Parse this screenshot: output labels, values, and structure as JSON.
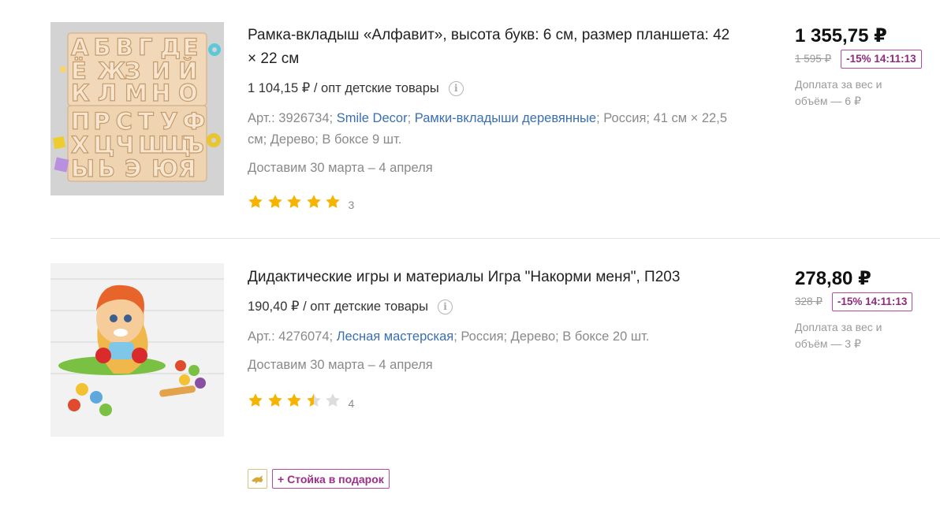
{
  "products": [
    {
      "title": "Рамка-вкладыш «Алфавит», высота букв: 6 см, размер планшета: 42 × 22 см",
      "wholesale": "1 104,15 ₽ / опт детские товары",
      "meta": {
        "art": "Арт.: 3926734",
        "brand": "Smile Decor",
        "category": "Рамки-вкладыши деревянные",
        "details": "Россия; 41 см × 22,5 см; Дерево; В боксе 9 шт."
      },
      "delivery": "Доставим 30 марта – 4 апреля",
      "rating": 5,
      "reviews": "3",
      "price": "1 355,75 ₽",
      "old_price": "1 595 ₽",
      "discount": "-15% 14:11:13",
      "surcharge": "Доплата за вес и объём — 6 ₽",
      "image_letters": [
        "А",
        "Б",
        "В",
        "Г",
        "Д",
        "Е",
        "Ё",
        "Ж",
        "З",
        "И",
        "Й",
        "К",
        "Л",
        "М",
        "Н",
        "О",
        "П",
        "Р",
        "С",
        "Т",
        "У",
        "Ф",
        "Х",
        "Ц",
        "Ч",
        "Ш",
        "Щ",
        "Ъ",
        "Ы",
        "Ь",
        "Э",
        "Ю",
        "Я"
      ]
    },
    {
      "title": "Дидактические игры и материалы Игра \"Накорми меня\", П203",
      "wholesale": "190,40 ₽ / опт детские товары",
      "meta": {
        "art": "Арт.: 4276074",
        "brand": "Лесная мастерская",
        "details": "Россия; Дерево; В боксе 20 шт."
      },
      "delivery": "Доставим 30 марта – 4 апреля",
      "rating": 3.5,
      "reviews": "4",
      "price": "278,80 ₽",
      "old_price": "328 ₽",
      "discount": "-15% 14:11:13",
      "surcharge": "Доплата за вес и объём — 3 ₽",
      "gift": "+ Стойка в подарок"
    }
  ],
  "icons": {
    "info": "info-icon",
    "star": "star-icon",
    "gift": "gift-icon"
  },
  "colors": {
    "link": "#3a6fb0",
    "star_filled": "#f6b300",
    "star_empty": "#dddddd",
    "discount_border": "#b44b9c",
    "discount_text": "#8e2a7c"
  }
}
